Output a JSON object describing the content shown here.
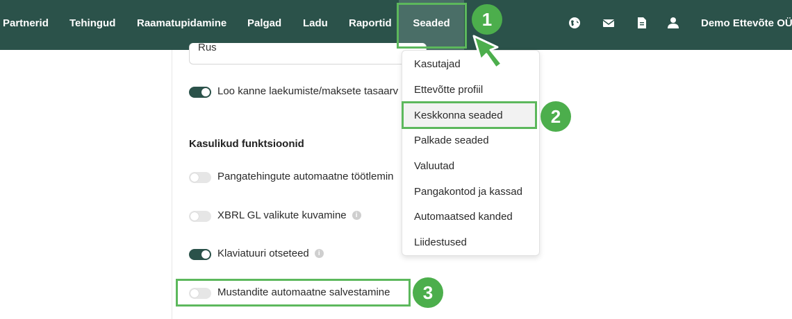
{
  "nav": {
    "items": [
      {
        "label": "Partnerid"
      },
      {
        "label": "Tehingud"
      },
      {
        "label": "Raamatupidamine"
      },
      {
        "label": "Palgad"
      },
      {
        "label": "Ladu"
      },
      {
        "label": "Raportid"
      },
      {
        "label": "Seaded"
      }
    ],
    "company": "Demo Ettevõte OÜ",
    "icons": [
      "globe-icon",
      "mail-icon",
      "document-icon",
      "user-icon"
    ],
    "background": "#2b524a"
  },
  "settings": {
    "language_value": "Rus",
    "toggles": [
      {
        "label": "Loo kanne laekumiste/maksete tasaarv",
        "on": true
      },
      {
        "label": "Pangatehingute automaatne töötlemin",
        "on": false
      },
      {
        "label": "XBRL GL valikute kuvamine",
        "on": false,
        "info": true
      },
      {
        "label": "Klaviatuuri otseteed",
        "on": true,
        "info": true
      },
      {
        "label": "Mustandite automaatne salvestamine",
        "on": false
      }
    ],
    "section_title": "Kasulikud funktsioonid",
    "info_glyph": "i"
  },
  "dropdown": {
    "items": [
      {
        "label": "Kasutajad"
      },
      {
        "label": "Ettevõtte profiil"
      },
      {
        "label": "Keskkonna seaded"
      },
      {
        "label": "Palkade seaded"
      },
      {
        "label": "Valuutad"
      },
      {
        "label": "Pangakontod ja kassad"
      },
      {
        "label": "Automaatsed kanded"
      },
      {
        "label": "Liidestused"
      }
    ],
    "highlighted": "Keskkonna seaded"
  },
  "callouts": {
    "step1": "1",
    "step2": "2",
    "step3": "3",
    "color": "#5cb85c"
  }
}
